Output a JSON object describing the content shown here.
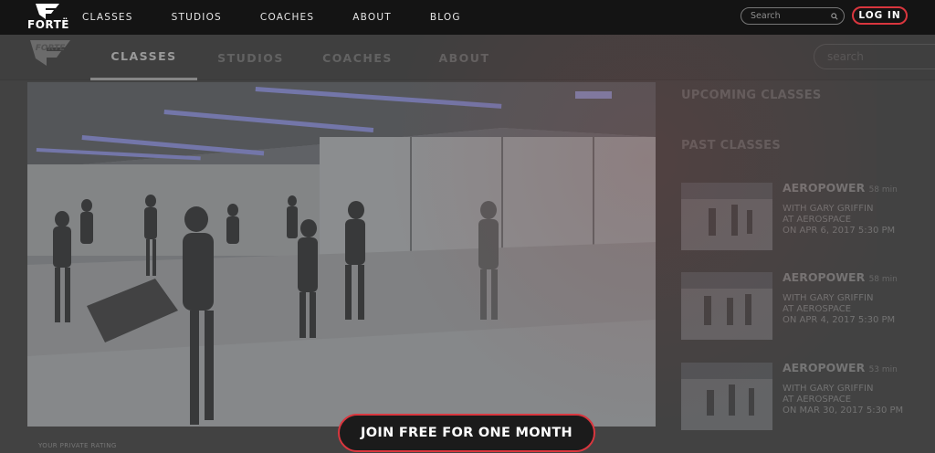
{
  "topbar": {
    "brand": "FORTË",
    "nav": [
      "CLASSES",
      "STUDIOS",
      "COACHES",
      "ABOUT",
      "BLOG"
    ],
    "search_placeholder": "Search",
    "login_label": "LOG IN",
    "accent": "#d9363e"
  },
  "subnav": {
    "brand": "FORTE",
    "tabs": [
      "CLASSES",
      "STUDIOS",
      "COACHES",
      "ABOUT"
    ],
    "active_tab": "CLASSES",
    "search_placeholder": "search"
  },
  "player": {
    "rating_label": "YOUR PRIVATE RATING"
  },
  "sidebar": {
    "upcoming_heading": "UPCOMING CLASSES",
    "past_heading": "PAST CLASSES",
    "classes": [
      {
        "title": "AEROPOWER",
        "duration": "58 min",
        "with_label": "WITH",
        "coach": "GARY GRIFFIN",
        "at_label": "AT",
        "studio": "AEROSPACE",
        "on_label": "ON",
        "date": "APR 6, 2017 5:30 PM"
      },
      {
        "title": "AEROPOWER",
        "duration": "58 min",
        "with_label": "WITH",
        "coach": "GARY GRIFFIN",
        "at_label": "AT",
        "studio": "AEROSPACE",
        "on_label": "ON",
        "date": "APR 4, 2017 5:30 PM"
      },
      {
        "title": "AEROPOWER",
        "duration": "53 min",
        "with_label": "WITH",
        "coach": "GARY GRIFFIN",
        "at_label": "AT",
        "studio": "AEROSPACE",
        "on_label": "ON",
        "date": "MAR 30, 2017 5:30 PM"
      }
    ]
  },
  "cta": {
    "label": "JOIN FREE FOR ONE MONTH"
  }
}
